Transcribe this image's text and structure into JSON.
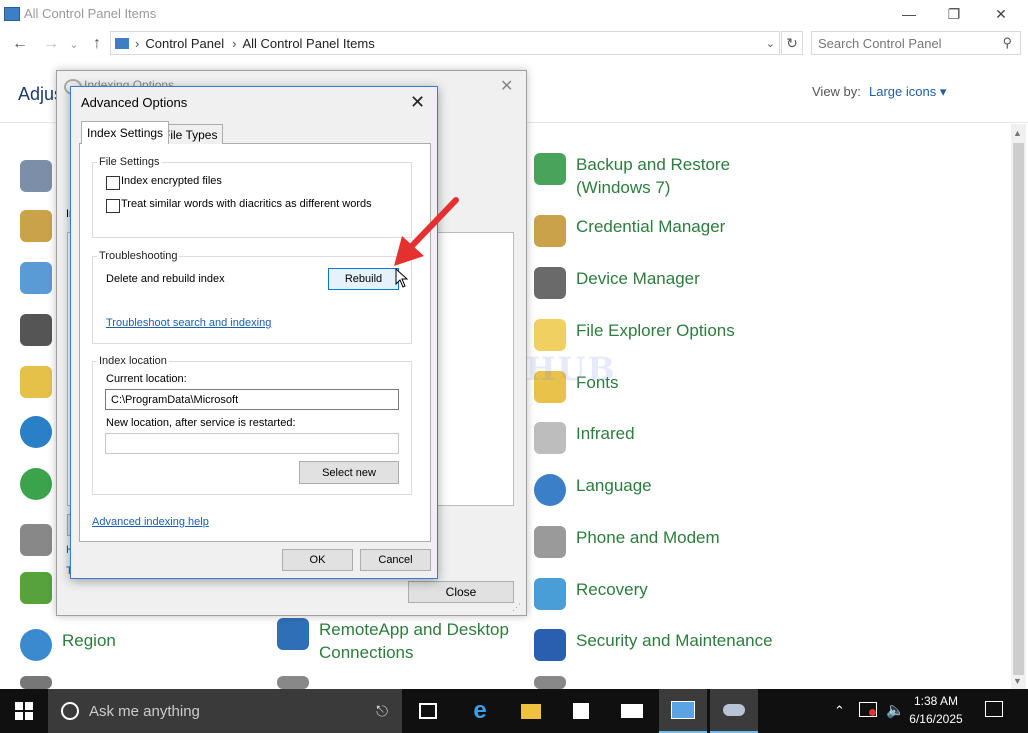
{
  "window": {
    "title": "All Control Panel Items",
    "address_crumb_1": "Control Panel",
    "address_crumb_2": "All Control Panel Items",
    "search_placeholder": "Search Control Panel"
  },
  "header": {
    "adjust_text": "Adjus",
    "view_by_label": "View by:",
    "view_by_value": "Large icons ▾"
  },
  "items": {
    "backup": "Backup and Restore\n(Windows 7)",
    "credential": "Credential Manager",
    "device": "Device Manager",
    "file_explorer": "File Explorer Options",
    "fonts": "Fonts",
    "infrared": "Infrared",
    "language": "Language",
    "phone": "Phone and Modem",
    "recovery": "Recovery",
    "region": "Region",
    "remoteapp": "RemoteApp and Desktop\nConnections",
    "security": "Security and Maintenance"
  },
  "indexing": {
    "title": "Indexing Options",
    "close_button": "Close"
  },
  "advanced": {
    "title": "Advanced Options",
    "tabs": [
      "Index Settings",
      "File Types"
    ],
    "file_settings": {
      "group": "File Settings",
      "encrypt": "Index encrypted files",
      "diacritics": "Treat similar words with diacritics as different words"
    },
    "troubleshooting": {
      "group": "Troubleshooting",
      "delete_rebuild": "Delete and rebuild index",
      "rebuild_button": "Rebuild",
      "troubleshoot_link": "Troubleshoot search and indexing"
    },
    "location": {
      "group": "Index location",
      "current_label": "Current location:",
      "current_value": "C:\\ProgramData\\Microsoft",
      "new_label": "New location, after service is restarted:",
      "new_value": "",
      "select_new": "Select new"
    },
    "help_link": "Advanced indexing help",
    "ok": "OK",
    "cancel": "Cancel"
  },
  "watermark": "IT Pros HUB",
  "taskbar": {
    "search_text": "Ask me anything",
    "time": "1:38 AM",
    "date": "6/16/2025"
  },
  "colors": {
    "item_label": "#2c7d3d",
    "link": "#1a5fb4",
    "dialog_border": "#3a7bd5",
    "arrow": "#e53030"
  }
}
